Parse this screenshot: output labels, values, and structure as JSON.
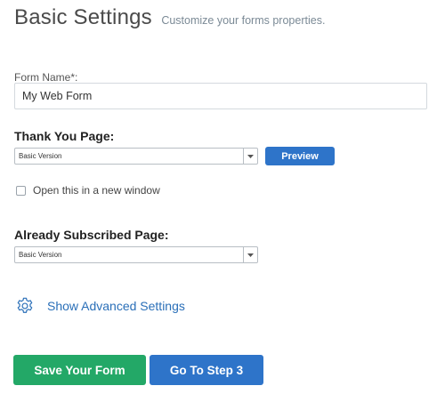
{
  "header": {
    "title": "Basic Settings",
    "subtitle": "Customize your forms properties."
  },
  "form_name": {
    "label": "Form Name*:",
    "value": "My Web Form"
  },
  "thank_you": {
    "label": "Thank You Page:",
    "selected": "Basic Version",
    "preview_label": "Preview",
    "checkbox_label": "Open this in a new window",
    "checkbox_checked": false
  },
  "already_subscribed": {
    "label": "Already Subscribed Page:",
    "selected": "Basic Version"
  },
  "advanced": {
    "link_label": "Show Advanced Settings",
    "icon": "gear-icon"
  },
  "actions": {
    "save_label": "Save Your Form",
    "step_label": "Go To Step 3"
  },
  "colors": {
    "primary_blue": "#2e74c9",
    "save_green": "#23a867",
    "link_blue": "#2a6fb8"
  }
}
